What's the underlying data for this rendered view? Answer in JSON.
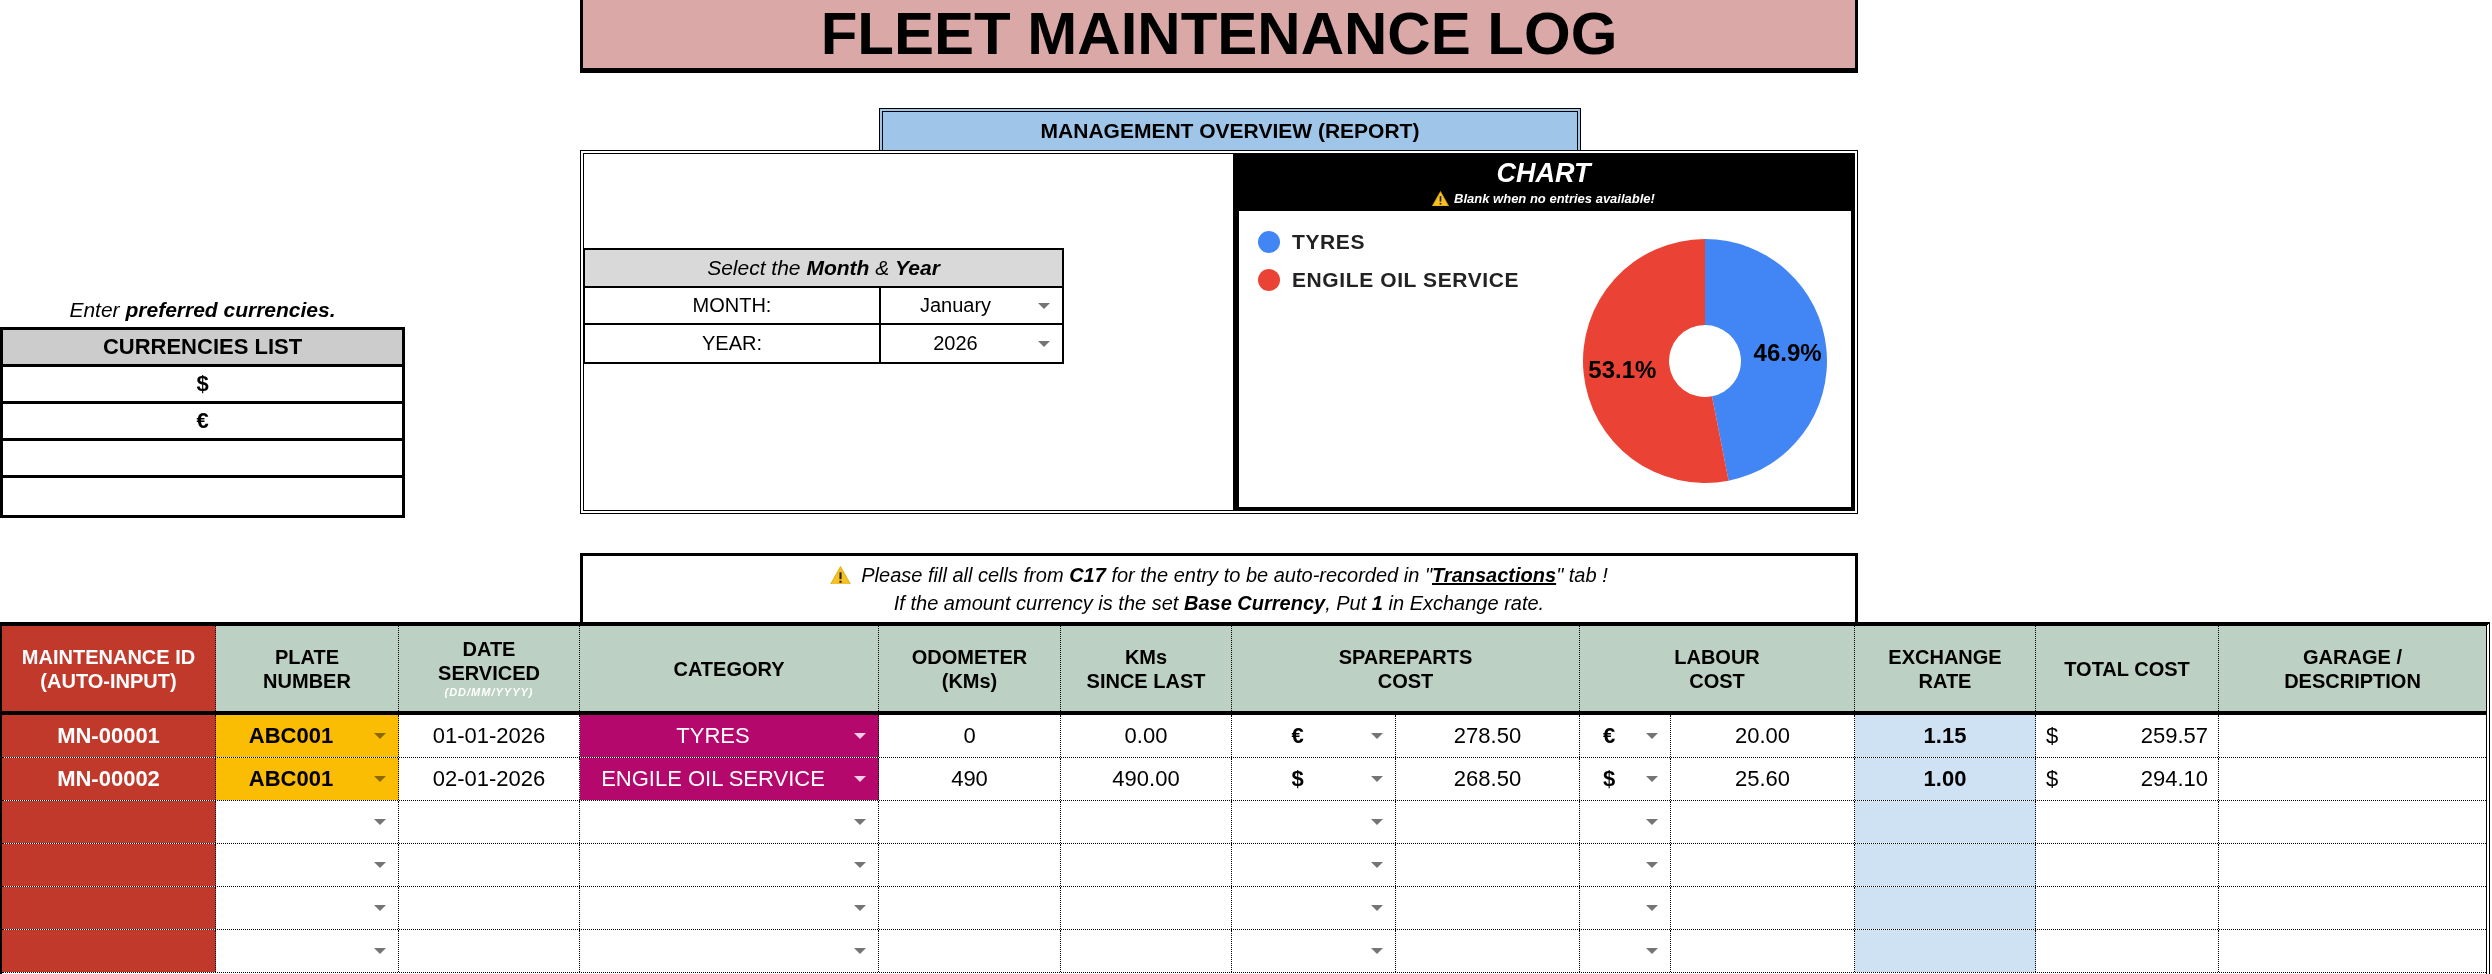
{
  "title": "FLEET MAINTENANCE LOG",
  "currencies": {
    "instruction": "Enter **preferred currencies.**",
    "header": "CURRENCIES LIST",
    "items": [
      "$",
      "€"
    ]
  },
  "report": {
    "header": "MANAGEMENT OVERVIEW (REPORT)",
    "period": {
      "header": "Select the **Month** & **Year**",
      "fields": [
        {
          "label": "MONTH:",
          "value": "January"
        },
        {
          "label": "YEAR:",
          "value": "2026"
        }
      ]
    },
    "chart": {
      "title": "CHART",
      "note": "Blank when no entries available!",
      "chart_data": {
        "type": "donut",
        "categories": [
          "TYRES",
          "ENGILE OIL SERVICE"
        ],
        "series": [
          {
            "values": [
              46.9,
              53.1
            ]
          }
        ],
        "colors": [
          "#4285f4",
          "#ea4335"
        ],
        "value_labels": [
          "46.9%",
          "53.1%"
        ],
        "legend": "left"
      }
    }
  },
  "notice": {
    "line_1": {
      "before": "Please fill all cells from **C17** for the entry to be auto-recorded in \"",
      "link": "Transactions",
      "after": "\" tab !"
    },
    "line_2": "If the amount currency is the set **Base Currency**, Put **1** in Exchange rate."
  },
  "table": {
    "columns": [
      {
        "label": "MAINTENANCE ID\n(AUTO-INPUT)",
        "kind": "id"
      },
      {
        "label": "PLATE\nNUMBER",
        "kind": "plate"
      },
      {
        "label": "DATE\nSERVICED",
        "hint": "(DD/MM/YYYY)",
        "kind": "text"
      },
      {
        "label": "CATEGORY",
        "kind": "category"
      },
      {
        "label": "ODOMETER\n(KMs)",
        "kind": "text"
      },
      {
        "label": "KMs\nSINCE LAST",
        "kind": "text"
      },
      {
        "label": "SPAREPARTS\nCOST",
        "kind": "money"
      },
      {
        "label": "LABOUR\nCOST",
        "kind": "money"
      },
      {
        "label": "EXCHANGE\nRATE",
        "kind": "rate"
      },
      {
        "label": "TOTAL COST",
        "kind": "total"
      },
      {
        "label": "GARAGE /\nDESCRIPTION",
        "kind": "text"
      }
    ],
    "rows": [
      [
        "MN-00001",
        "ABC001",
        "01-01-2026",
        "TYRES",
        "0",
        "0.00",
        {
          "currency": "€",
          "amount": "278.50"
        },
        {
          "currency": "€",
          "amount": "20.00"
        },
        "1.15",
        {
          "currency": "$",
          "amount": "259.57"
        }
      ],
      [
        "MN-00002",
        "ABC001",
        "02-01-2026",
        "ENGILE OIL SERVICE",
        "490",
        "490.00",
        {
          "currency": "$",
          "amount": "268.50"
        },
        {
          "currency": "$",
          "amount": "25.60"
        },
        "1.00",
        {
          "currency": "$",
          "amount": "294.10"
        }
      ]
    ]
  }
}
